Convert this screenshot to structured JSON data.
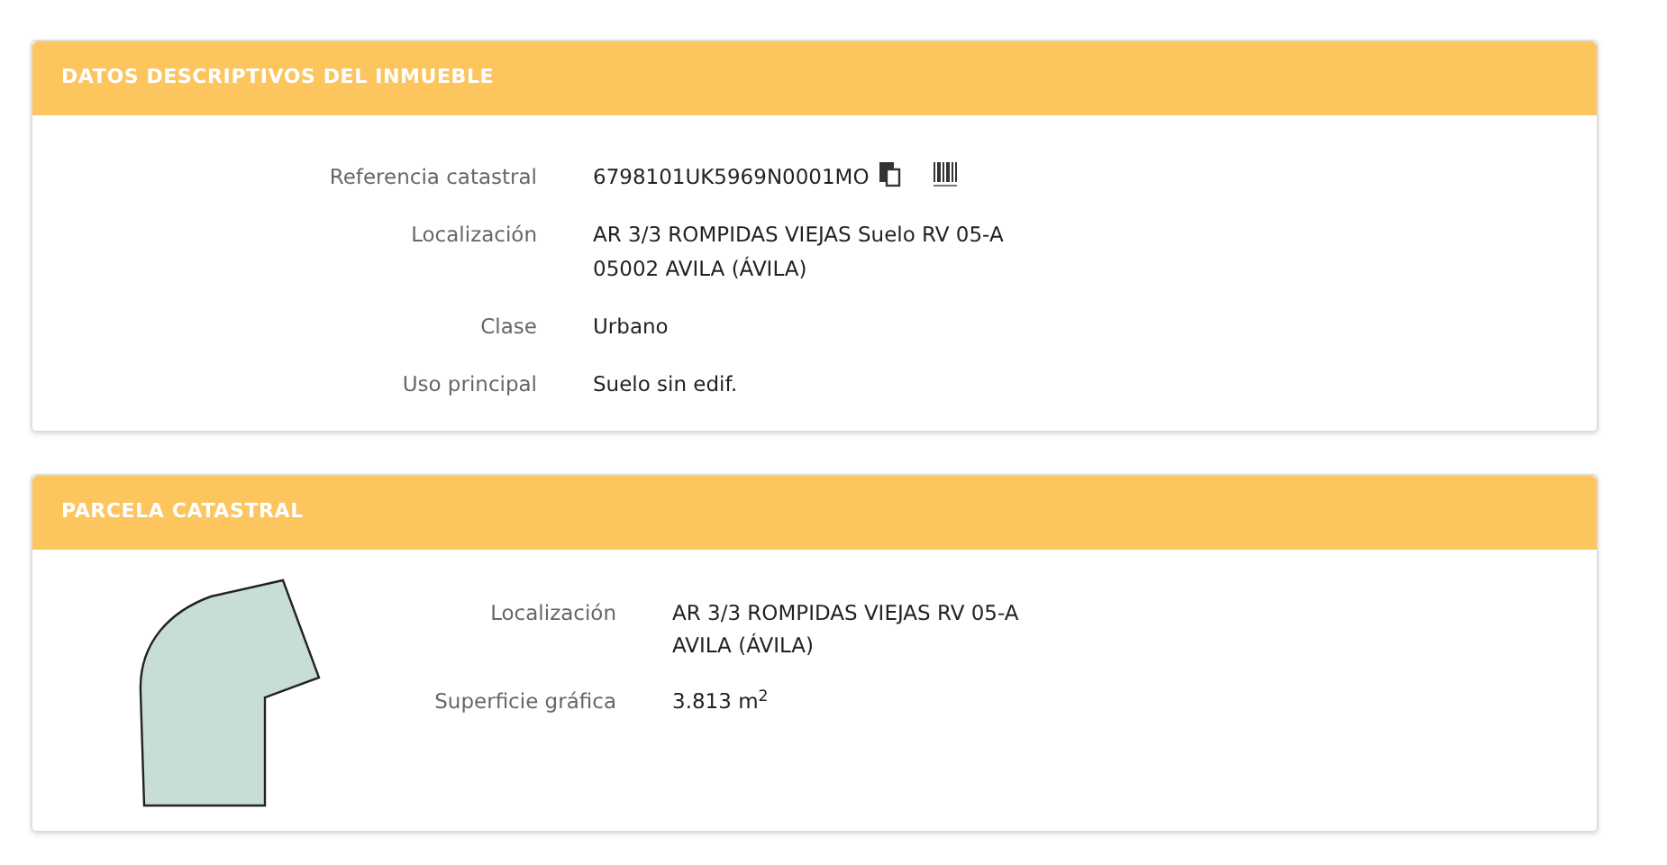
{
  "inmueble": {
    "title": "DATOS DESCRIPTIVOS DEL INMUEBLE",
    "rows": [
      {
        "label": "Referencia catastral",
        "lines": [
          "6798101UK5969N0001MO"
        ],
        "kind": "reference"
      },
      {
        "label": "Localización",
        "lines": [
          "AR 3/3 ROMPIDAS VIEJAS Suelo RV 05-A",
          "05002 AVILA (ÁVILA)"
        ],
        "kind": "text"
      },
      {
        "label": "Clase",
        "lines": [
          "Urbano"
        ],
        "kind": "text"
      },
      {
        "label": "Uso principal",
        "lines": [
          "Suelo sin edif."
        ],
        "kind": "text"
      }
    ]
  },
  "parcela": {
    "title": "PARCELA CATASTRAL",
    "rows": [
      {
        "label": "Localización",
        "lines": [
          "AR 3/3 ROMPIDAS VIEJAS RV 05-A",
          "AVILA (ÁVILA)"
        ],
        "kind": "text"
      },
      {
        "label": "Superficie gráfica",
        "lines": [
          "3.813 m$^{2}$"
        ],
        "kind": "text"
      }
    ]
  }
}
